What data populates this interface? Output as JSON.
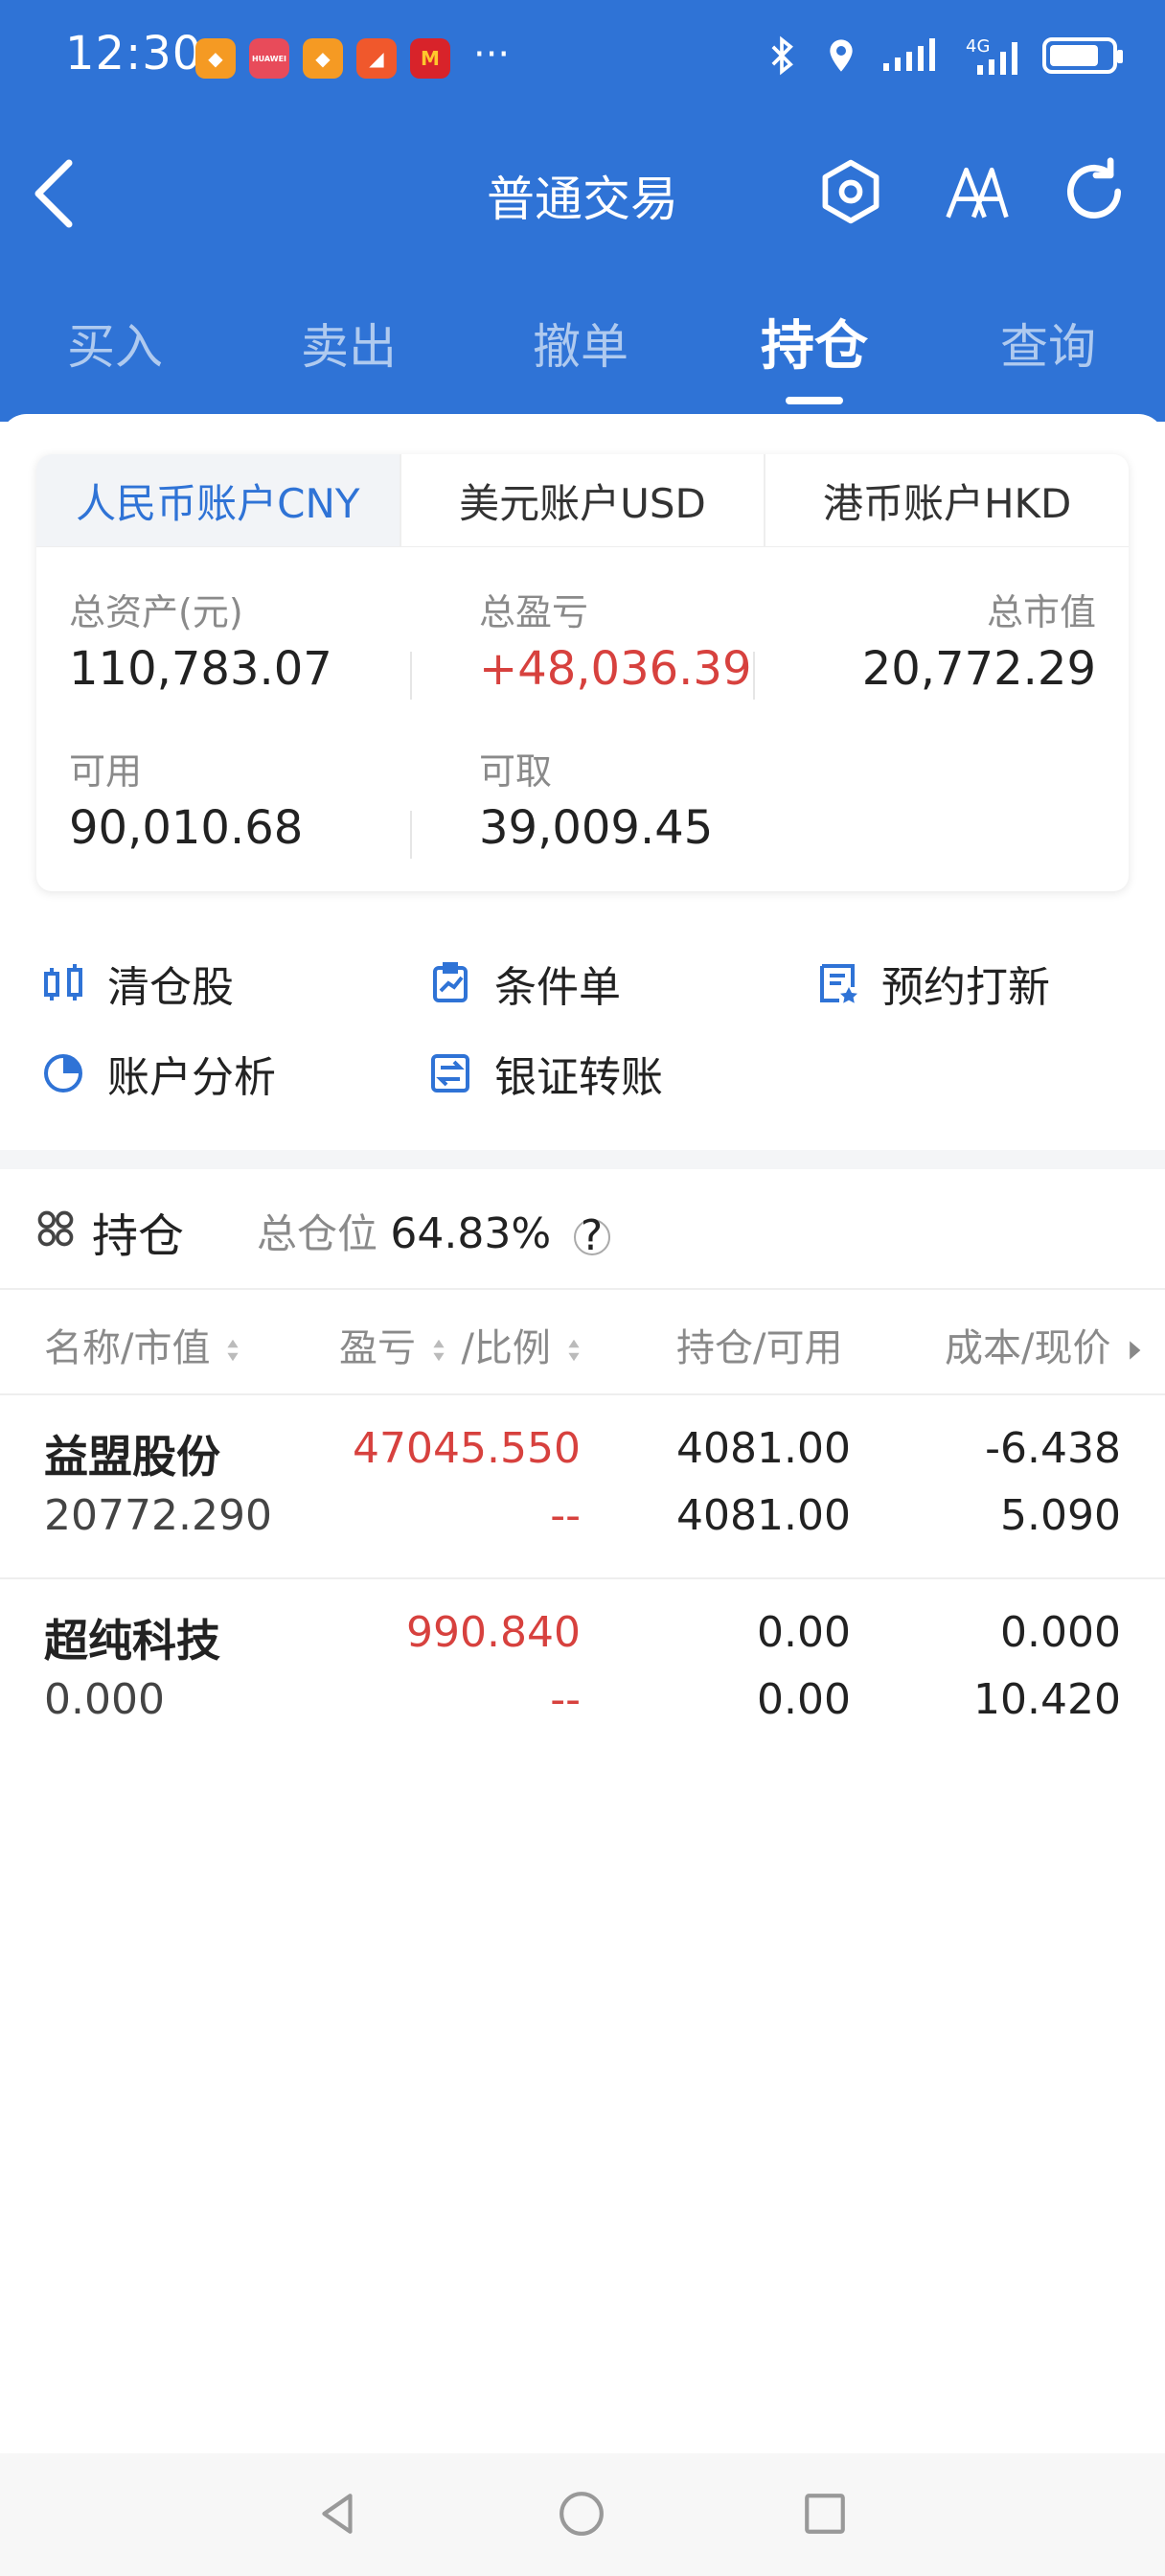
{
  "status_bar": {
    "time": "12:30",
    "more": "···",
    "huawei_icon_text": "HUAWEI"
  },
  "nav": {
    "title": "普通交易"
  },
  "tabs": [
    {
      "label": "买入"
    },
    {
      "label": "卖出"
    },
    {
      "label": "撤单"
    },
    {
      "label": "持仓",
      "active": true
    },
    {
      "label": "查询"
    }
  ],
  "account_tabs": [
    "人民币账户CNY",
    "美元账户USD",
    "港币账户HKD"
  ],
  "summary": {
    "total_assets_label": "总资产(元)",
    "total_assets": "110,783.07",
    "total_pl_label": "总盈亏",
    "total_pl": "+48,036.39",
    "market_value_label": "总市值",
    "market_value": "20,772.29",
    "available_label": "可用",
    "available": "90,010.68",
    "withdrawable_label": "可取",
    "withdrawable": "39,009.45"
  },
  "quick_actions": [
    {
      "label": "清仓股",
      "icon": "clear-position-icon"
    },
    {
      "label": "条件单",
      "icon": "conditional-order-icon"
    },
    {
      "label": "预约打新",
      "icon": "ipo-reservation-icon"
    },
    {
      "label": "账户分析",
      "icon": "pie-chart-icon"
    },
    {
      "label": "银证转账",
      "icon": "transfer-icon"
    }
  ],
  "holdings": {
    "title": "持仓",
    "ratio_label": "总仓位",
    "ratio_value": "64.83%",
    "help": "?",
    "columns": [
      "名称/市值",
      "盈亏",
      "/比例",
      "持仓/可用",
      "成本/现价"
    ],
    "rows": [
      {
        "name": "益盟股份",
        "market_value": "20772.290",
        "pl": "47045.550",
        "ratio": "--",
        "position": "4081.00",
        "available": "4081.00",
        "cost": "-6.438",
        "price": "5.090"
      },
      {
        "name": "超纯科技",
        "market_value": "0.000",
        "pl": "990.840",
        "ratio": "--",
        "position": "0.00",
        "available": "0.00",
        "cost": "0.000",
        "price": "10.420"
      }
    ]
  },
  "colors": {
    "brand_blue": "#2f73d6",
    "loss_profit_red": "#d7413e"
  }
}
